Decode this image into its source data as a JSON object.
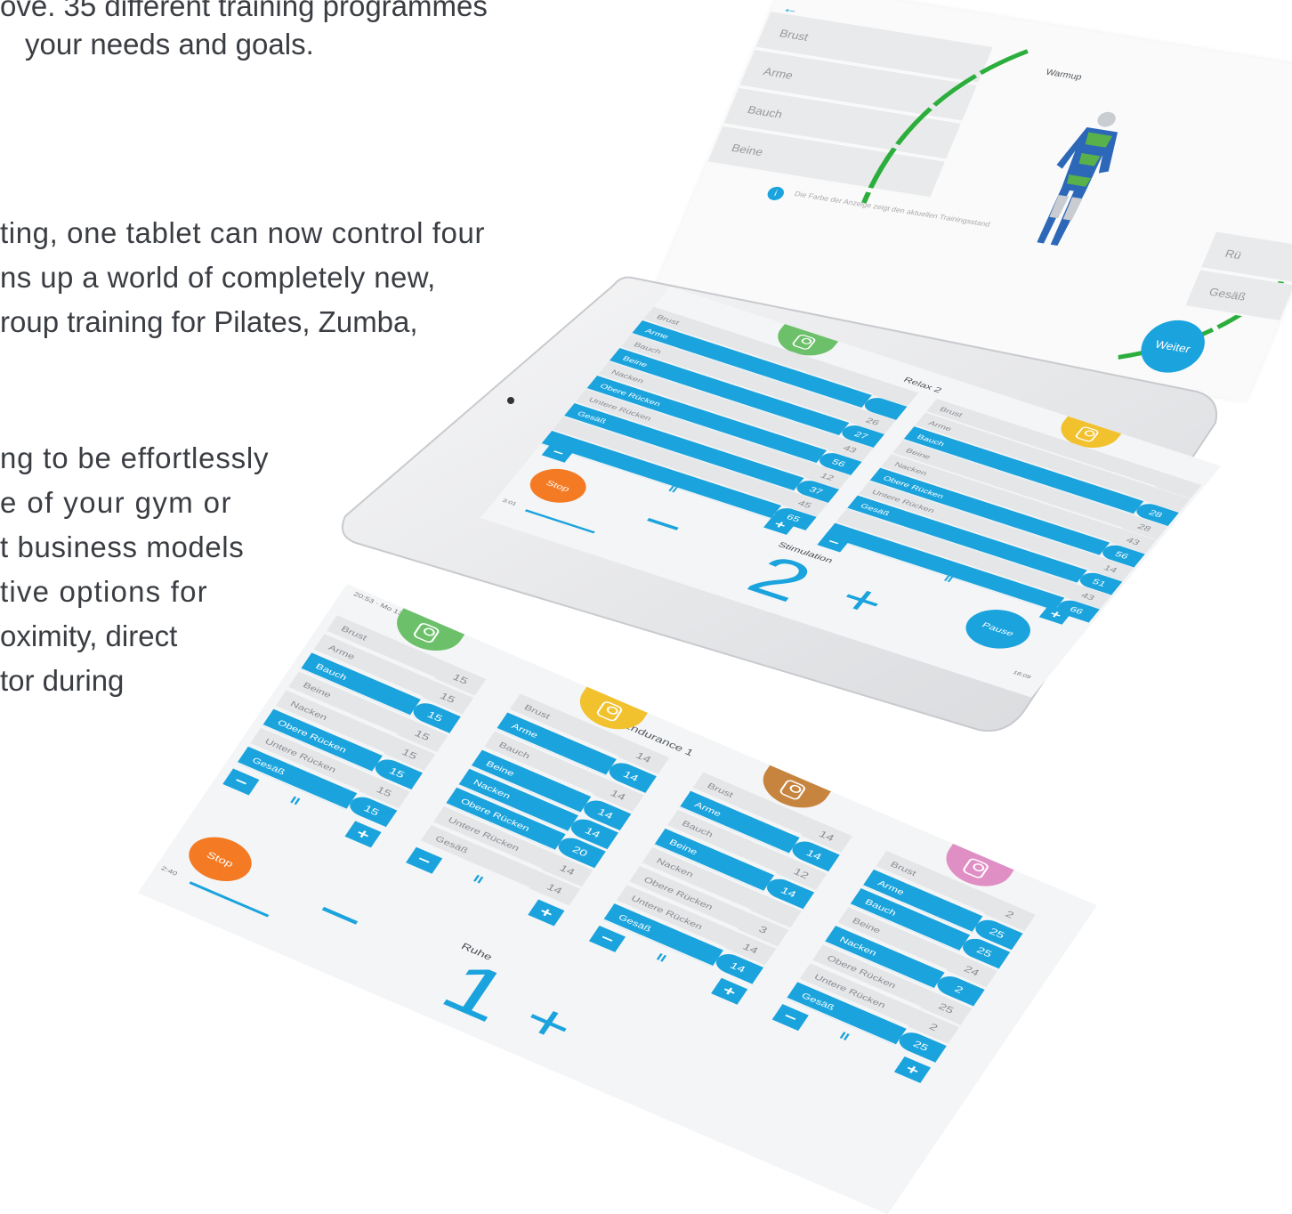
{
  "copy": {
    "lines": [
      "ove. 35 different training programmes",
      "your needs and goals.",
      "ting, one tablet can now control four",
      "ns up a world of completely new,",
      "roup training for Pilates, Zumba,",
      "ng to be effortlessly",
      "e of your gym or",
      "t business models",
      "tive options for",
      "oximity, direct",
      "tor during"
    ]
  },
  "colors": {
    "accent_blue": "#1aa3dd",
    "stop_orange": "#f47a23",
    "green": "#6cc06a",
    "yellow": "#f2c12e",
    "brown": "#c7843f",
    "pink": "#e08fc4",
    "curve_green": "#2bae3c"
  },
  "warmup": {
    "title": "Warmup",
    "muscles": [
      "Brust",
      "Arme",
      "Bauch",
      "Beine"
    ],
    "right_labels": [
      "Rü",
      "Gesäß"
    ],
    "info": "Die Farbe der Anzeige zeigt den aktuellen Trainingsstand",
    "button": "Weiter",
    "back_icon": "back-arrow-icon"
  },
  "relax": {
    "title": "Relax 2",
    "status": "Stimulation",
    "big_value": "2",
    "stop": "Stop",
    "pause": "Pause",
    "time_left": "3:01",
    "time_right": "18:09",
    "left_rows": [
      {
        "label": "Brust",
        "value": "",
        "active": false
      },
      {
        "label": "Arme",
        "value": "",
        "active": true
      },
      {
        "label": "Bauch",
        "value": "26",
        "active": false
      },
      {
        "label": "Beine",
        "value": "27",
        "active": true
      },
      {
        "label": "Nacken",
        "value": "43",
        "active": false
      },
      {
        "label": "Obere Rücken",
        "value": "56",
        "active": true
      },
      {
        "label": "Untere Rücken",
        "value": "12",
        "active": false
      },
      {
        "label": "Gesäß",
        "value": "37",
        "active": true
      },
      {
        "label": "",
        "value": "45",
        "active": false
      },
      {
        "label": "",
        "value": "65",
        "active": true
      }
    ],
    "right_rows": [
      {
        "label": "Brust",
        "value": "",
        "active": false
      },
      {
        "label": "Arme",
        "value": "",
        "active": false
      },
      {
        "label": "Bauch",
        "value": "28",
        "active": true
      },
      {
        "label": "Beine",
        "value": "28",
        "active": false
      },
      {
        "label": "Nacken",
        "value": "43",
        "active": false
      },
      {
        "label": "Obere Rücken",
        "value": "56",
        "active": true
      },
      {
        "label": "Untere Rücken",
        "value": "14",
        "active": false
      },
      {
        "label": "Gesäß",
        "value": "51",
        "active": true
      },
      {
        "label": "",
        "value": "43",
        "active": false
      },
      {
        "label": "",
        "value": "66",
        "active": true
      }
    ]
  },
  "endurance": {
    "title": "Endurance 1",
    "status": "Ruhe",
    "big_value": "1",
    "stop": "Stop",
    "time": "2:40",
    "columns": [
      {
        "color": "#6cc06a",
        "rows": [
          {
            "label": "Brust",
            "value": "15",
            "active": false
          },
          {
            "label": "Arme",
            "value": "15",
            "active": false
          },
          {
            "label": "Bauch",
            "value": "15",
            "active": true
          },
          {
            "label": "Beine",
            "value": "15",
            "active": false
          },
          {
            "label": "Nacken",
            "value": "15",
            "active": false
          },
          {
            "label": "Obere Rücken",
            "value": "15",
            "active": true
          },
          {
            "label": "Untere Rücken",
            "value": "15",
            "active": false
          },
          {
            "label": "Gesäß",
            "value": "15",
            "active": true
          }
        ]
      },
      {
        "color": "#f2c12e",
        "rows": [
          {
            "label": "Brust",
            "value": "14",
            "active": false
          },
          {
            "label": "Arme",
            "value": "14",
            "active": true
          },
          {
            "label": "Bauch",
            "value": "14",
            "active": false
          },
          {
            "label": "Beine",
            "value": "14",
            "active": true
          },
          {
            "label": "Nacken",
            "value": "14",
            "active": true
          },
          {
            "label": "Obere Rücken",
            "value": "20",
            "active": true
          },
          {
            "label": "Untere Rücken",
            "value": "14",
            "active": false
          },
          {
            "label": "Gesäß",
            "value": "14",
            "active": false
          }
        ]
      },
      {
        "color": "#c7843f",
        "rows": [
          {
            "label": "Brust",
            "value": "14",
            "active": false
          },
          {
            "label": "Arme",
            "value": "14",
            "active": true
          },
          {
            "label": "Bauch",
            "value": "12",
            "active": false
          },
          {
            "label": "Beine",
            "value": "14",
            "active": true
          },
          {
            "label": "Nacken",
            "value": "",
            "active": false
          },
          {
            "label": "Obere Rücken",
            "value": "3",
            "active": false
          },
          {
            "label": "Untere Rücken",
            "value": "14",
            "active": false
          },
          {
            "label": "Gesäß",
            "value": "14",
            "active": true
          }
        ]
      },
      {
        "color": "#e08fc4",
        "rows": [
          {
            "label": "Brust",
            "value": "2",
            "active": false
          },
          {
            "label": "Arme",
            "value": "25",
            "active": true
          },
          {
            "label": "Bauch",
            "value": "25",
            "active": true
          },
          {
            "label": "Beine",
            "value": "24",
            "active": false
          },
          {
            "label": "Nacken",
            "value": "2",
            "active": true
          },
          {
            "label": "Obere Rücken",
            "value": "25",
            "active": false
          },
          {
            "label": "Untere Rücken",
            "value": "2",
            "active": false
          },
          {
            "label": "Gesäß",
            "value": "25",
            "active": true
          }
        ]
      }
    ]
  }
}
